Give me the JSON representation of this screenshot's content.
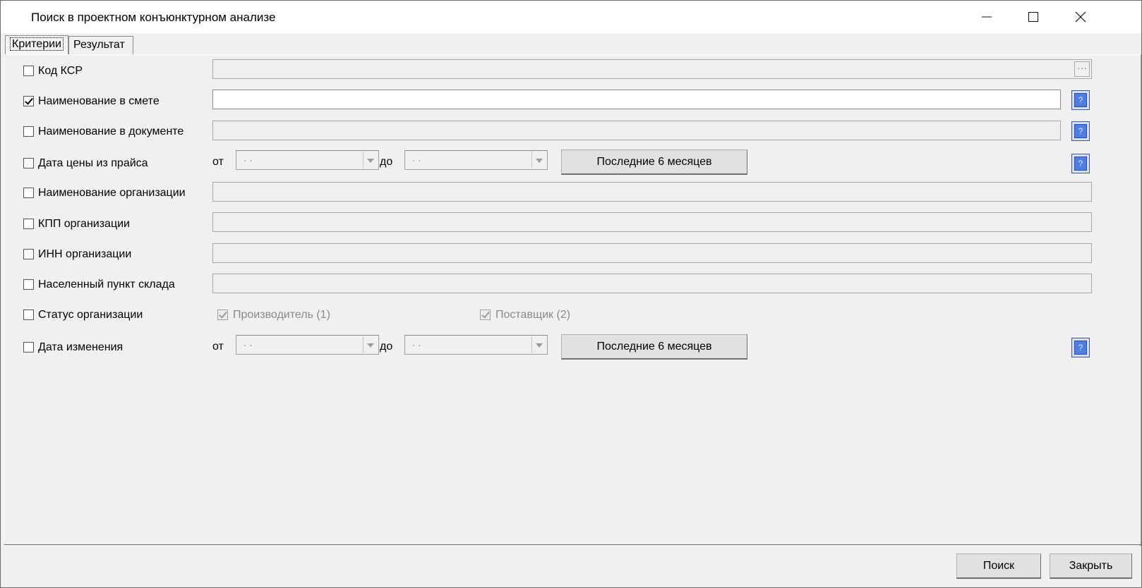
{
  "window": {
    "title": "Поиск в проектном конъюнктурном анализе"
  },
  "tabs": [
    "Критерии",
    "Результат"
  ],
  "rows": {
    "ksr_code": {
      "label": "Код КСР",
      "checked": false,
      "dots": "···"
    },
    "name_estimate": {
      "label": "Наименование в смете",
      "checked": true,
      "value": ""
    },
    "name_document": {
      "label": "Наименование в документе",
      "checked": false
    },
    "price_date": {
      "label": "Дата цены из прайса",
      "checked": false,
      "from_label": "от",
      "from_value": ". .",
      "to_label": "до",
      "to_value": ". .",
      "preset_button": "Последние 6 месяцев"
    },
    "org_name": {
      "label": "Наименование организации",
      "checked": false
    },
    "org_kpp": {
      "label": "КПП организации",
      "checked": false
    },
    "org_inn": {
      "label": "ИНН организации",
      "checked": false
    },
    "warehouse_city": {
      "label": "Населенный пункт склада",
      "checked": false
    },
    "org_status": {
      "label": "Статус организации",
      "checked": false,
      "producer": "Производитель (1)",
      "producer_checked": true,
      "supplier": "Поставщик (2)",
      "supplier_checked": true
    },
    "change_date": {
      "label": "Дата изменения",
      "checked": false,
      "from_label": "от",
      "from_value": ". .",
      "to_label": "до",
      "to_value": ". .",
      "preset_button": "Последние 6 месяцев"
    }
  },
  "help_glyph": "?",
  "footer": {
    "search": "Поиск",
    "close": "Закрыть"
  }
}
